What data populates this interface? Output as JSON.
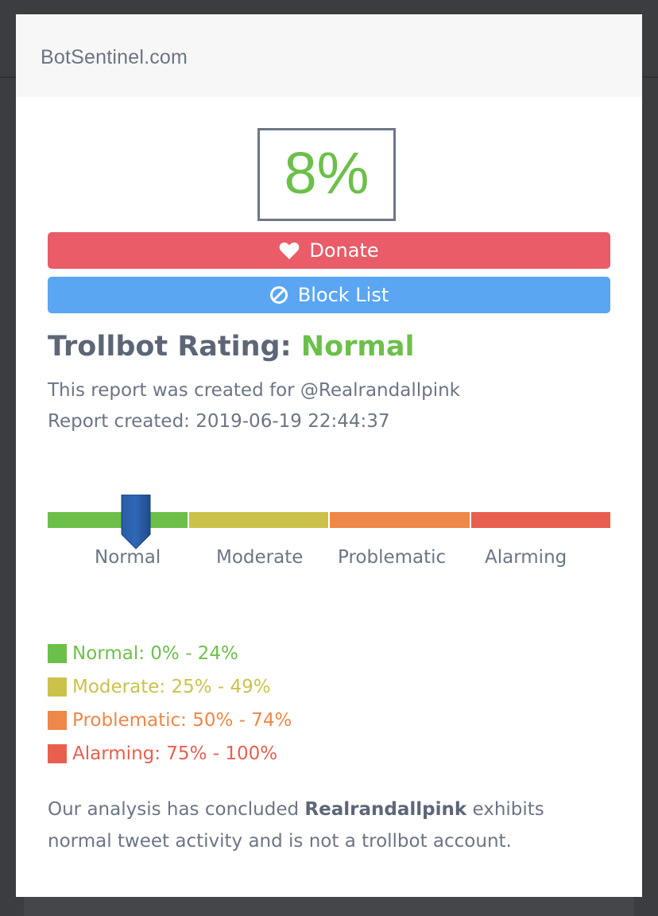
{
  "header": {
    "site_title": "BotSentinel.com"
  },
  "score": {
    "value": "8%",
    "percent": 8,
    "color": "#6cc04a"
  },
  "buttons": {
    "donate_label": "Donate",
    "block_list_label": "Block List"
  },
  "rating": {
    "prefix": "Trollbot Rating:",
    "value": "Normal",
    "report_for": "This report was created for @Realrandallpink",
    "report_created": "Report created: 2019-06-19 22:44:37"
  },
  "scale": {
    "marker_percent": 8,
    "labels": [
      "Normal",
      "Moderate",
      "Problematic",
      "Alarming"
    ],
    "colors": [
      "#6cc04a",
      "#cbc24c",
      "#ee8748",
      "#e85f4d"
    ]
  },
  "legend": [
    {
      "label": "Normal: 0% - 24%",
      "color": "#6cc04a"
    },
    {
      "label": "Moderate: 25% - 49%",
      "color": "#cbc24c"
    },
    {
      "label": "Problematic: 50% - 74%",
      "color": "#ee8748"
    },
    {
      "label": "Alarming: 75% - 100%",
      "color": "#e85f4d"
    }
  ],
  "conclusion": {
    "before": "Our analysis has concluded ",
    "account": "Realrandallpink",
    "after": " exhibits normal tweet activity and is not a trollbot account."
  },
  "icons": {
    "donate": "heart-icon",
    "block_list": "block-icon",
    "marker": "marker-pointer-icon"
  }
}
